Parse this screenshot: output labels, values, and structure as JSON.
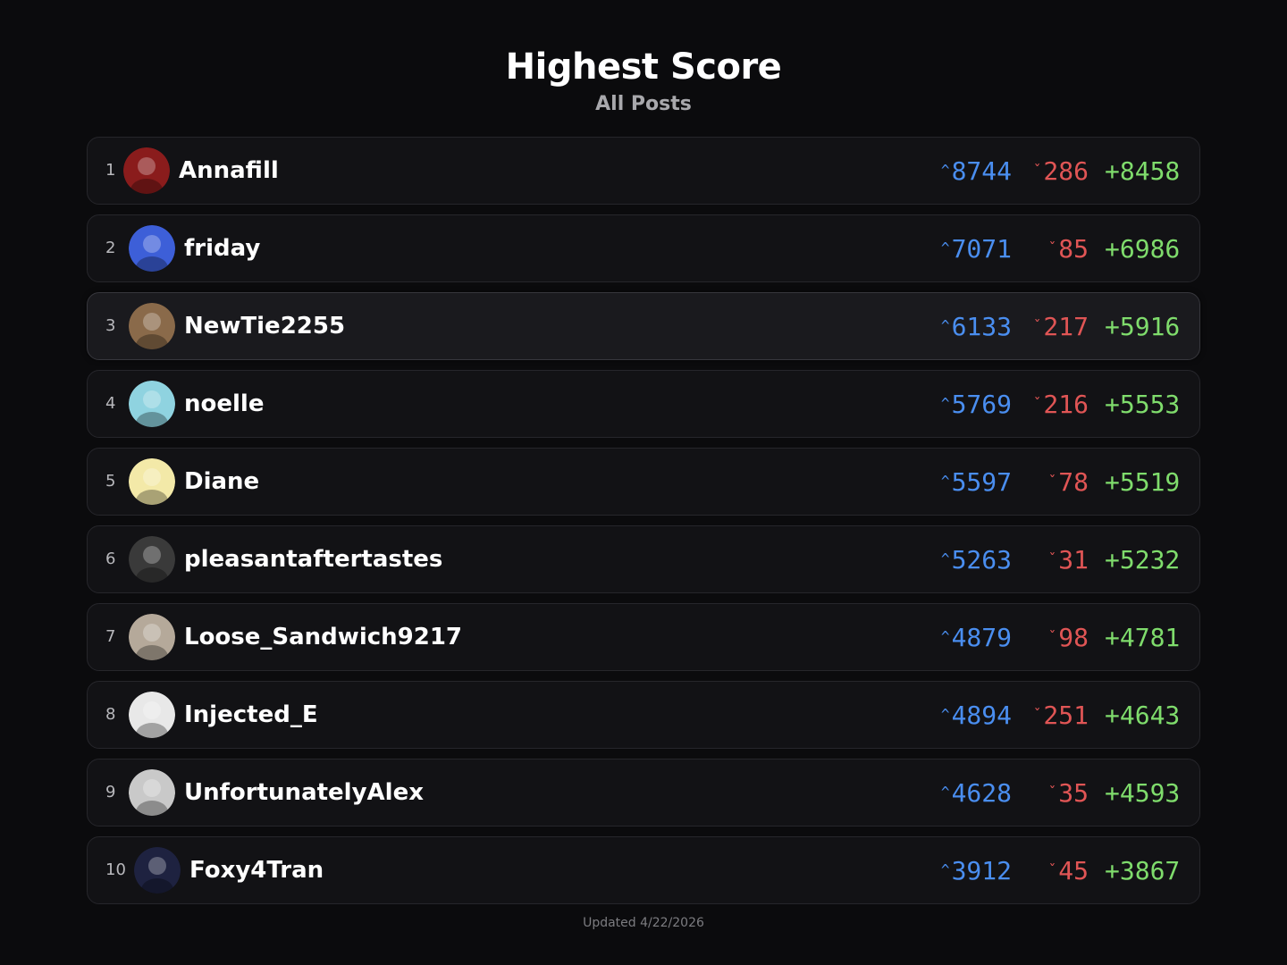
{
  "header": {
    "title": "Highest Score",
    "subtitle": "All Posts"
  },
  "leaderboard": [
    {
      "rank": "1",
      "name": "Annafill",
      "up": "8744",
      "down": "286",
      "net": "+8458",
      "avatar_color": "#8a1c1c"
    },
    {
      "rank": "2",
      "name": "friday",
      "up": "7071",
      "down": "85",
      "net": "+6986",
      "avatar_color": "#3d5fd8"
    },
    {
      "rank": "3",
      "name": "NewTie2255",
      "up": "6133",
      "down": "217",
      "net": "+5916",
      "avatar_color": "#8a6a4a"
    },
    {
      "rank": "4",
      "name": "noelle",
      "up": "5769",
      "down": "216",
      "net": "+5553",
      "avatar_color": "#8fd3e0"
    },
    {
      "rank": "5",
      "name": "Diane",
      "up": "5597",
      "down": "78",
      "net": "+5519",
      "avatar_color": "#f3e9a8"
    },
    {
      "rank": "6",
      "name": "pleasantaftertastes",
      "up": "5263",
      "down": "31",
      "net": "+5232",
      "avatar_color": "#3a3a3a"
    },
    {
      "rank": "7",
      "name": "Loose_Sandwich9217",
      "up": "4879",
      "down": "98",
      "net": "+4781",
      "avatar_color": "#b5a99a"
    },
    {
      "rank": "8",
      "name": "Injected_E",
      "up": "4894",
      "down": "251",
      "net": "+4643",
      "avatar_color": "#e8e8e8"
    },
    {
      "rank": "9",
      "name": "UnfortunatelyAlex",
      "up": "4628",
      "down": "35",
      "net": "+4593",
      "avatar_color": "#c9c9c9"
    },
    {
      "rank": "10",
      "name": "Foxy4Tran",
      "up": "3912",
      "down": "45",
      "net": "+3867",
      "avatar_color": "#1e2240"
    }
  ],
  "icons": {
    "up": "upvote-chevron-icon",
    "down": "downvote-chevron-icon"
  },
  "footer": {
    "updated": "Updated 4/22/2026"
  },
  "colors": {
    "upvote": "#4a8ef0",
    "downvote": "#e05555",
    "net": "#7fdc6c",
    "background": "#0b0b0d",
    "row": "#121215"
  }
}
